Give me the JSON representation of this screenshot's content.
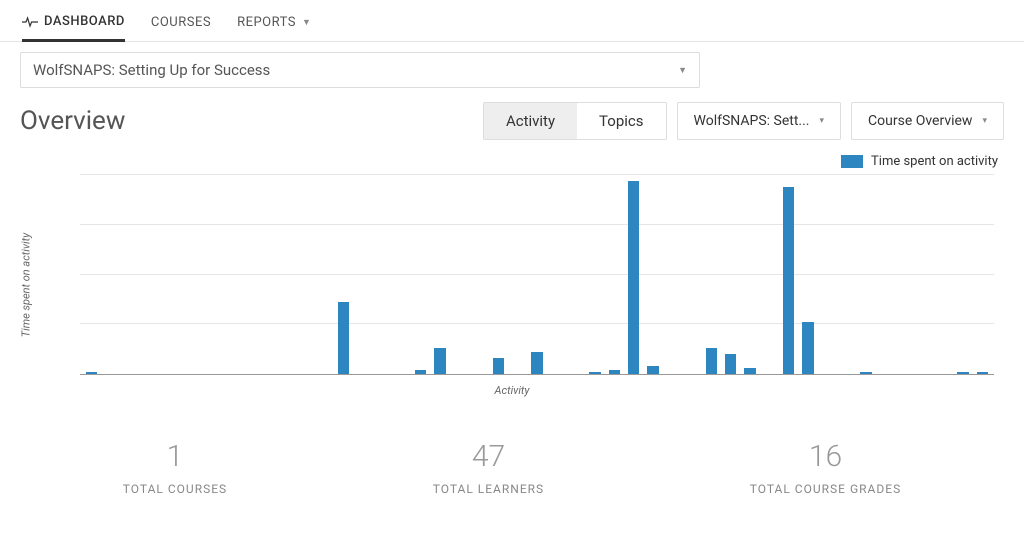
{
  "nav": {
    "items": [
      {
        "label": "DASHBOARD",
        "active": true
      },
      {
        "label": "COURSES",
        "active": false
      },
      {
        "label": "REPORTS",
        "active": false,
        "dropdown": true
      }
    ]
  },
  "course_select": {
    "value": "WolfSNAPS: Setting Up for Success"
  },
  "page_title": "Overview",
  "tabs": {
    "items": [
      {
        "label": "Activity",
        "active": true
      },
      {
        "label": "Topics",
        "active": false
      }
    ]
  },
  "dropdowns": {
    "course_filter": "WolfSNAPS: Sett...",
    "view_filter": "Course Overview"
  },
  "legend_label": "Time spent on activity",
  "stats": {
    "courses": {
      "value": "1",
      "label": "TOTAL COURSES"
    },
    "learners": {
      "value": "47",
      "label": "TOTAL LEARNERS"
    },
    "grades": {
      "value": "16",
      "label": "TOTAL COURSE GRADES"
    }
  },
  "chart_data": {
    "type": "bar",
    "title": "",
    "xlabel": "Activity",
    "ylabel": "Time spent on activity",
    "ylim": [
      0,
      100
    ],
    "grid": true,
    "legend": {
      "position": "top-right",
      "entries": [
        "Time spent on activity"
      ]
    },
    "series": [
      {
        "name": "Time spent on activity",
        "color": "#2E86C1",
        "values": [
          1,
          0,
          0,
          0,
          0,
          0,
          0,
          0,
          0,
          0,
          0,
          0,
          0,
          36,
          0,
          0,
          0,
          2,
          13,
          0,
          0,
          8,
          0,
          11,
          0,
          0,
          1,
          2,
          97,
          4,
          0,
          0,
          13,
          10,
          3,
          0,
          94,
          26,
          0,
          0,
          1,
          0,
          0,
          0,
          0,
          1,
          1
        ]
      }
    ]
  }
}
